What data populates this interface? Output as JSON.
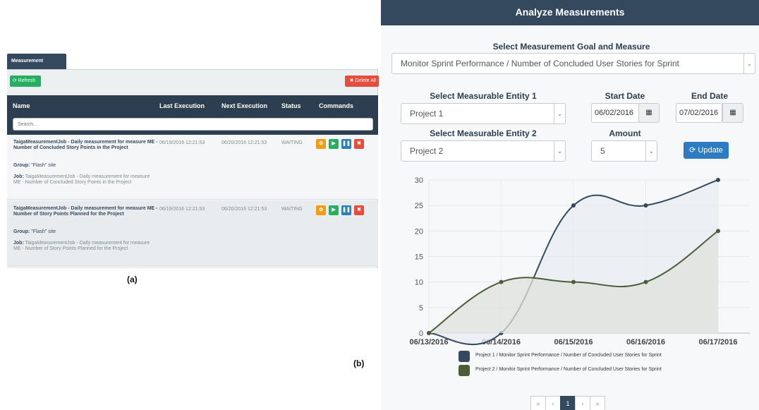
{
  "panel_a": {
    "tab_label": "Measurement Schedule",
    "refresh_label": "⟳ Refresh",
    "delete_all_label": "✖ Delete All",
    "columns": [
      "Name",
      "Last Execution",
      "Next Execution",
      "Status",
      "Commands"
    ],
    "search_placeholder": "Search...",
    "rows": [
      {
        "title": "TaigaMeasurementJob - Daily measurement for measure ME - Number of Concluded Story Points in the Project",
        "last": "06/19/2016 12:21:53",
        "next": "06/20/2016 12:21:53",
        "status": "WAITING",
        "group_label": "Group:",
        "group_value": " \"Flash\" site",
        "job_label": "Job:",
        "job_value": " TaigaMeasurementJob - Daily measurement for measure ME - Number of Concluded Story Points in the Project"
      },
      {
        "title": "TaigaMeasurementJob - Daily measurement for measure ME - Number of Story Points Planned for the Project",
        "last": "06/19/2016 12:21:53",
        "next": "06/20/2016 12:21:53",
        "status": "WAITING",
        "group_label": "Group:",
        "group_value": " \"Flash\" site",
        "job_label": "Job:",
        "job_value": " TaigaMeasurementJob - Daily measurement for measure ME - Number of Story Points Planned for the Project"
      }
    ],
    "caption": "(a)"
  },
  "panel_b": {
    "header_title": "Analyze Measurements",
    "goal_label": "Select Measurement Goal and Measure",
    "goal_value": "Monitor Sprint Performance / Number of Concluded User Stories for Sprint",
    "entity1_label": "Select Measurable Entity 1",
    "entity1_value": "Project 1",
    "entity2_label": "Select Measurable Entity 2",
    "entity2_value": "Project 2",
    "start_label": "Start Date",
    "start_value": "06/02/2016",
    "end_label": "End Date",
    "end_value": "07/02/2016",
    "amount_label": "Amount",
    "amount_value": "5",
    "update_label": "⟳ Update",
    "pager": [
      "«",
      "‹",
      "1",
      "›",
      "»"
    ],
    "caption": "(b)"
  },
  "chart_data": {
    "type": "area",
    "categories": [
      "06/13/2016",
      "06/14/2016",
      "06/15/2016",
      "06/16/2016",
      "06/17/2016"
    ],
    "ylim": [
      0,
      30
    ],
    "yticks": [
      0,
      5,
      10,
      15,
      20,
      25,
      30
    ],
    "series": [
      {
        "name": "Project 1 / Monitor Sprint Performance / Number of Concluded User Stories for Sprint",
        "values": [
          0,
          0,
          25,
          25,
          30
        ],
        "color": "#34495e",
        "fill": "#e8ecf2"
      },
      {
        "name": "Project 2 / Monitor Sprint Performance / Number of Concluded User Stories for Sprint",
        "values": [
          0,
          10,
          10,
          10,
          20
        ],
        "color": "#4a5d37",
        "fill": "#dfe2dc"
      }
    ],
    "grid": true,
    "legend": "bottom"
  }
}
